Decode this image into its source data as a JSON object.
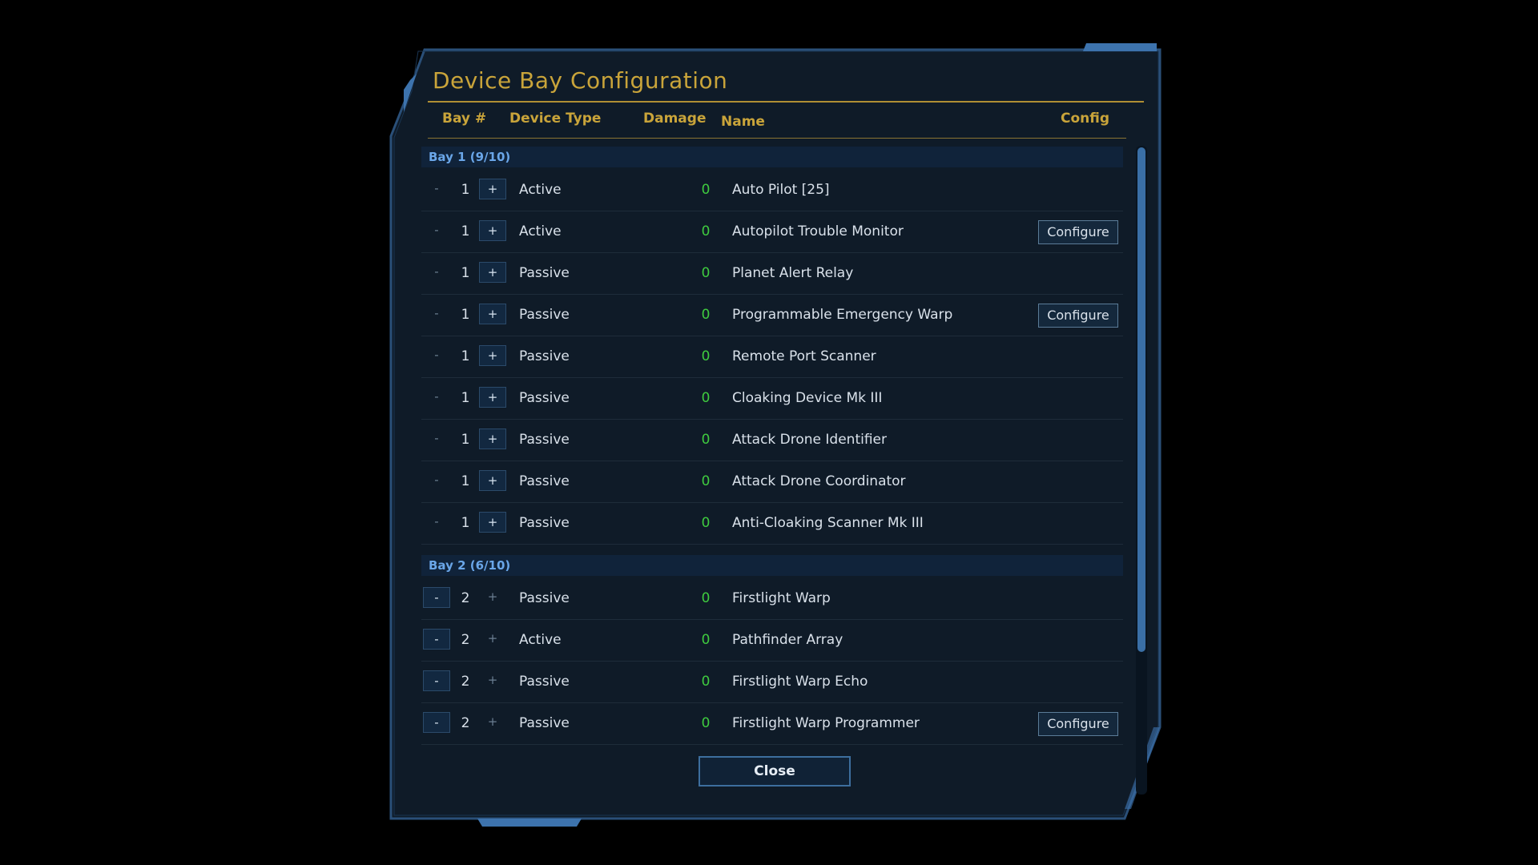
{
  "dialog": {
    "title": "Device Bay Configuration",
    "columns": {
      "bay": "Bay #",
      "device_type": "Device Type",
      "damage": "Damage",
      "name": "Name",
      "config": "Config"
    },
    "close_label": "Close",
    "accent_color": "#c9a43a",
    "frame_color": "#3d73ad"
  },
  "controls": {
    "minus": "-",
    "plus": "+",
    "configure": "Configure"
  },
  "bays": [
    {
      "label": "Bay 1 (9/10)",
      "rows": [
        {
          "qty": "1",
          "type": "Active",
          "damage": "0",
          "name": "Auto Pilot [25]",
          "configurable": false
        },
        {
          "qty": "1",
          "type": "Active",
          "damage": "0",
          "name": "Autopilot Trouble Monitor",
          "configurable": true
        },
        {
          "qty": "1",
          "type": "Passive",
          "damage": "0",
          "name": "Planet Alert Relay",
          "configurable": false
        },
        {
          "qty": "1",
          "type": "Passive",
          "damage": "0",
          "name": "Programmable Emergency Warp",
          "configurable": true
        },
        {
          "qty": "1",
          "type": "Passive",
          "damage": "0",
          "name": "Remote Port Scanner",
          "configurable": false
        },
        {
          "qty": "1",
          "type": "Passive",
          "damage": "0",
          "name": "Cloaking Device Mk III",
          "configurable": false
        },
        {
          "qty": "1",
          "type": "Passive",
          "damage": "0",
          "name": "Attack Drone Identifier",
          "configurable": false
        },
        {
          "qty": "1",
          "type": "Passive",
          "damage": "0",
          "name": "Attack Drone Coordinator",
          "configurable": false
        },
        {
          "qty": "1",
          "type": "Passive",
          "damage": "0",
          "name": "Anti-Cloaking Scanner Mk III",
          "configurable": false
        }
      ]
    },
    {
      "label": "Bay 2 (6/10)",
      "rows": [
        {
          "qty": "2",
          "type": "Passive",
          "damage": "0",
          "name": "Firstlight Warp",
          "configurable": false
        },
        {
          "qty": "2",
          "type": "Active",
          "damage": "0",
          "name": "Pathfinder Array",
          "configurable": false
        },
        {
          "qty": "2",
          "type": "Passive",
          "damage": "0",
          "name": "Firstlight Warp Echo",
          "configurable": false
        },
        {
          "qty": "2",
          "type": "Passive",
          "damage": "0",
          "name": "Firstlight Warp Programmer",
          "configurable": true
        }
      ]
    }
  ]
}
